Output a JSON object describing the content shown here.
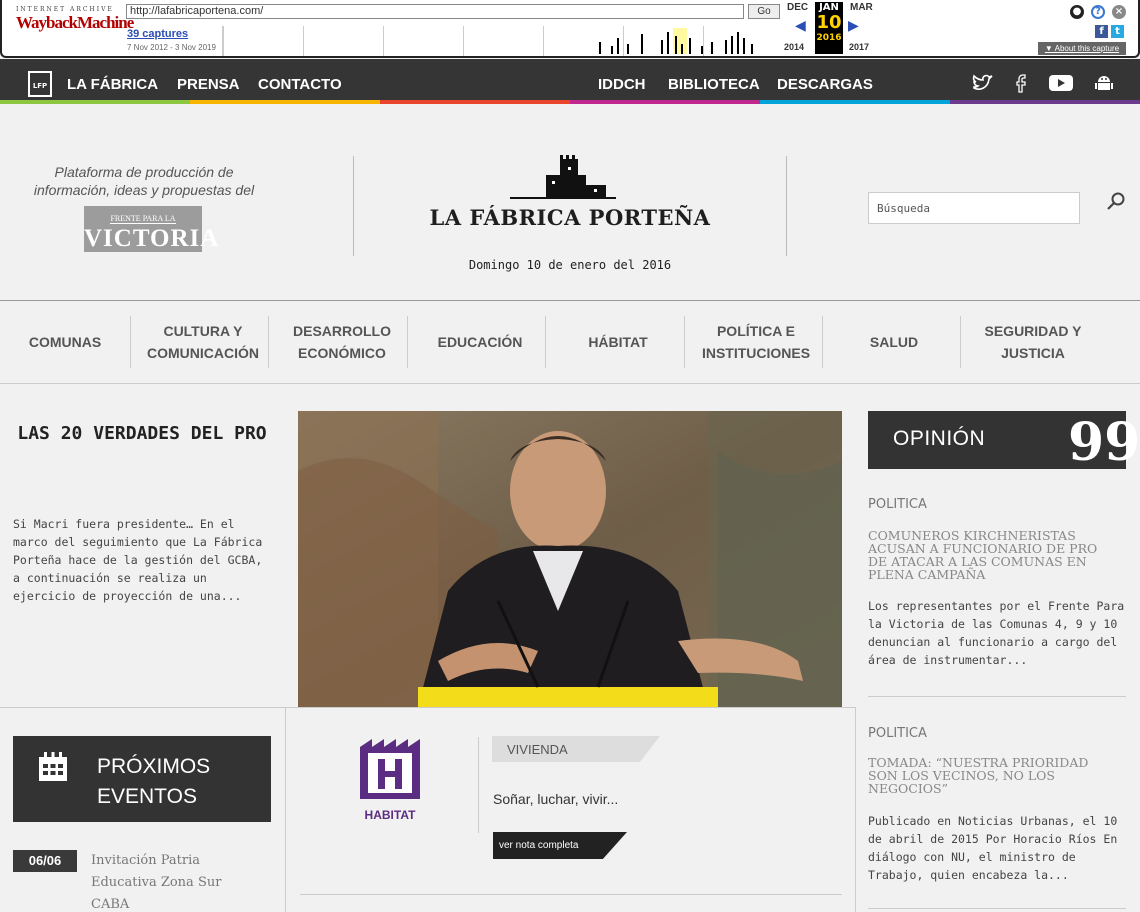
{
  "wayback": {
    "logo_top": "INTERNET ARCHIVE",
    "logo_main": "WaybackMachine",
    "url": "http://lafabricaportena.com/",
    "go_label": "Go",
    "captures": "39 captures",
    "range": "7 Nov 2012 - 3 Nov 2019",
    "prev_month": "DEC",
    "cur_month": "JAN",
    "next_month": "MAR",
    "prev_year": "2014",
    "cur_day": "10",
    "cur_year": "2016",
    "next_year": "2017",
    "about": "▼ About this capture"
  },
  "nav": {
    "left": [
      "LA FÁBRICA",
      "PRENSA",
      "CONTACTO"
    ],
    "center": [
      "IDDCH",
      "BIBLIOTECA",
      "DESCARGAS"
    ],
    "logo_text": "LFP",
    "strip_colors": [
      "#8dc63f",
      "#f7b500",
      "#e8452c",
      "#c1268e",
      "#00a3da",
      "#6d3b8e"
    ]
  },
  "header": {
    "tagline": "Plataforma de producción de información, ideas y propuestas del",
    "fpv_small": "FRENTE PARA LA",
    "fpv_big": "VICTORIA",
    "site_title": "LA FÁBRICA PORTEÑA",
    "date": "Domingo 10 de enero del 2016",
    "search_placeholder": "Búsqueda"
  },
  "categories": [
    {
      "label": "COMUNAS"
    },
    {
      "label": "CULTURA Y COMUNICACIÓN"
    },
    {
      "label": "DESARROLLO ECONÓMICO"
    },
    {
      "label": "EDUCACIÓN"
    },
    {
      "label": "HÁBITAT"
    },
    {
      "label": "POLÍTICA E INSTITUCIONES"
    },
    {
      "label": "SALUD"
    },
    {
      "label": "SEGURIDAD Y JUSTICIA"
    }
  ],
  "lead": {
    "title": "LAS 20 VERDADES DEL PRO",
    "excerpt": "Si Macri fuera presidente… En el marco del seguimiento que La Fábrica Porteña hace de la gestión del GCBA, a continuación se realiza un ejercicio de proyección de una..."
  },
  "opinion": {
    "label": "OPINIÓN",
    "quote_glyph": "99",
    "items": [
      {
        "category": "POLITICA",
        "title": "COMUNEROS KIRCHNERISTAS ACUSAN A FUNCIONARIO DE PRO DE ATACAR A LAS COMUNAS EN PLENA CAMPAÑA",
        "excerpt": "Los representantes por el Frente Para la Victoria de las Comunas 4, 9 y 10 denuncian al funcionario a cargo del área de instrumentar..."
      },
      {
        "category": "POLITICA",
        "title": "TOMADA: “NUESTRA PRIORIDAD SON LOS VECINOS, NO LOS NEGOCIOS”",
        "excerpt": "Publicado en Noticias Urbanas, el 10 de abril de 2015 Por Horacio Ríos En diálogo con NU, el ministro de Trabajo, quien encabeza la..."
      }
    ]
  },
  "events": {
    "title_line1": "PRÓXIMOS",
    "title_line2": "EVENTOS",
    "items": [
      {
        "date": "06/06",
        "text": "Invitación Patria Educativa Zona Sur CABA"
      }
    ]
  },
  "feature": {
    "icon_label": "HABITAT",
    "tag": "VIVIENDA",
    "headline": "Soñar, luchar, vivir...",
    "read_more": "ver nota completa",
    "accent": "#5a2d82"
  }
}
